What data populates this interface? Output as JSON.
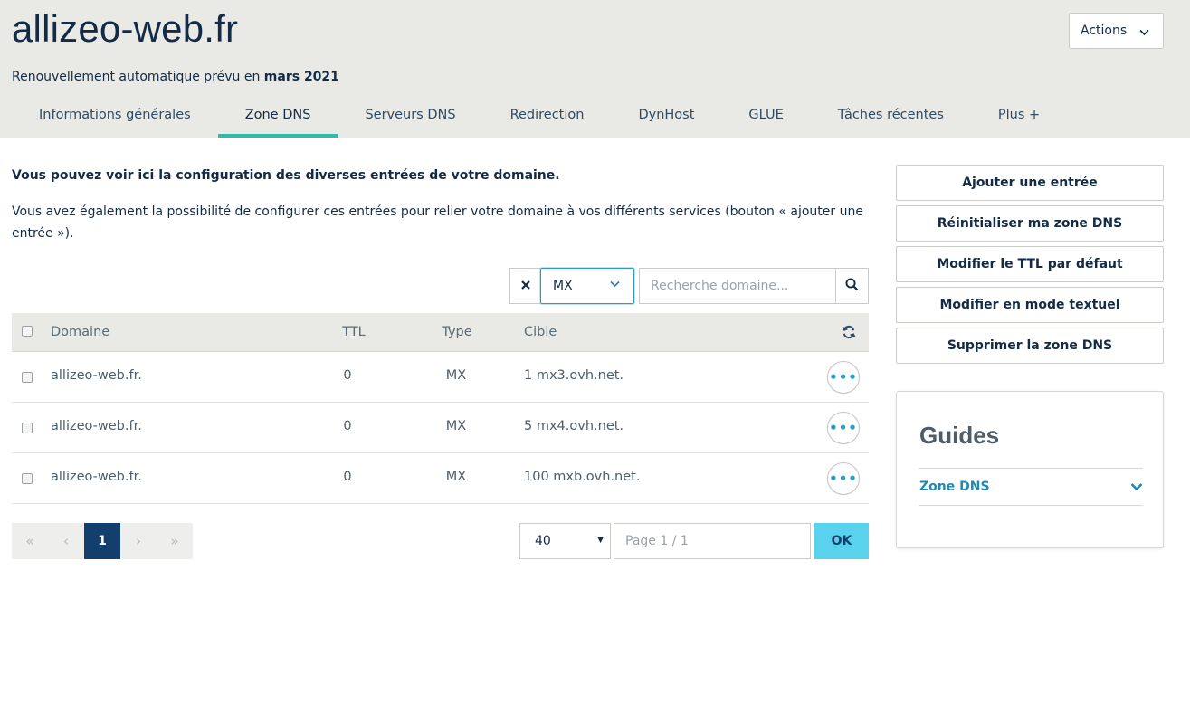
{
  "header": {
    "domain": "allizeo-web.fr",
    "renew_text": "Renouvellement automatique prévu en ",
    "renew_date": "mars 2021",
    "actions_label": "Actions"
  },
  "tabs": [
    {
      "label": "Informations générales",
      "active": false
    },
    {
      "label": "Zone DNS",
      "active": true
    },
    {
      "label": "Serveurs DNS",
      "active": false
    },
    {
      "label": "Redirection",
      "active": false
    },
    {
      "label": "DynHost",
      "active": false
    },
    {
      "label": "GLUE",
      "active": false
    },
    {
      "label": "Tâches récentes",
      "active": false
    },
    {
      "label": "Plus +",
      "active": false
    }
  ],
  "intro": {
    "bold": "Vous pouvez voir ici la configuration des diverses entrées de votre domaine.",
    "text": "Vous avez également la possibilité de configurer ces entrées pour relier votre domaine à vos différents services (bouton « ajouter une entrée »)."
  },
  "filter": {
    "type_value": "MX",
    "search_placeholder": "Recherche domaine..."
  },
  "table": {
    "columns": {
      "domaine": "Domaine",
      "ttl": "TTL",
      "type": "Type",
      "cible": "Cible"
    },
    "rows": [
      {
        "domaine": "allizeo-web.fr.",
        "ttl": "0",
        "type": "MX",
        "cible": "1 mx3.ovh.net."
      },
      {
        "domaine": "allizeo-web.fr.",
        "ttl": "0",
        "type": "MX",
        "cible": "5 mx4.ovh.net."
      },
      {
        "domaine": "allizeo-web.fr.",
        "ttl": "0",
        "type": "MX",
        "cible": "100 mxb.ovh.net."
      }
    ]
  },
  "pagination": {
    "first": "«",
    "prev": "‹",
    "current": "1",
    "next": "›",
    "last": "»",
    "per_page": "40",
    "page_placeholder": "Page 1 / 1",
    "ok_label": "OK"
  },
  "side_actions": [
    "Ajouter une entrée",
    "Réinitialiser ma zone DNS",
    "Modifier le TTL par défaut",
    "Modifier en mode textuel",
    "Supprimer la zone DNS"
  ],
  "guides": {
    "title": "Guides",
    "item": "Zone DNS"
  },
  "colors": {
    "accent_tab": "#2bbcac",
    "pager_active": "#123f6d",
    "ok_button": "#59d2ee",
    "link": "#1e8bb5"
  }
}
